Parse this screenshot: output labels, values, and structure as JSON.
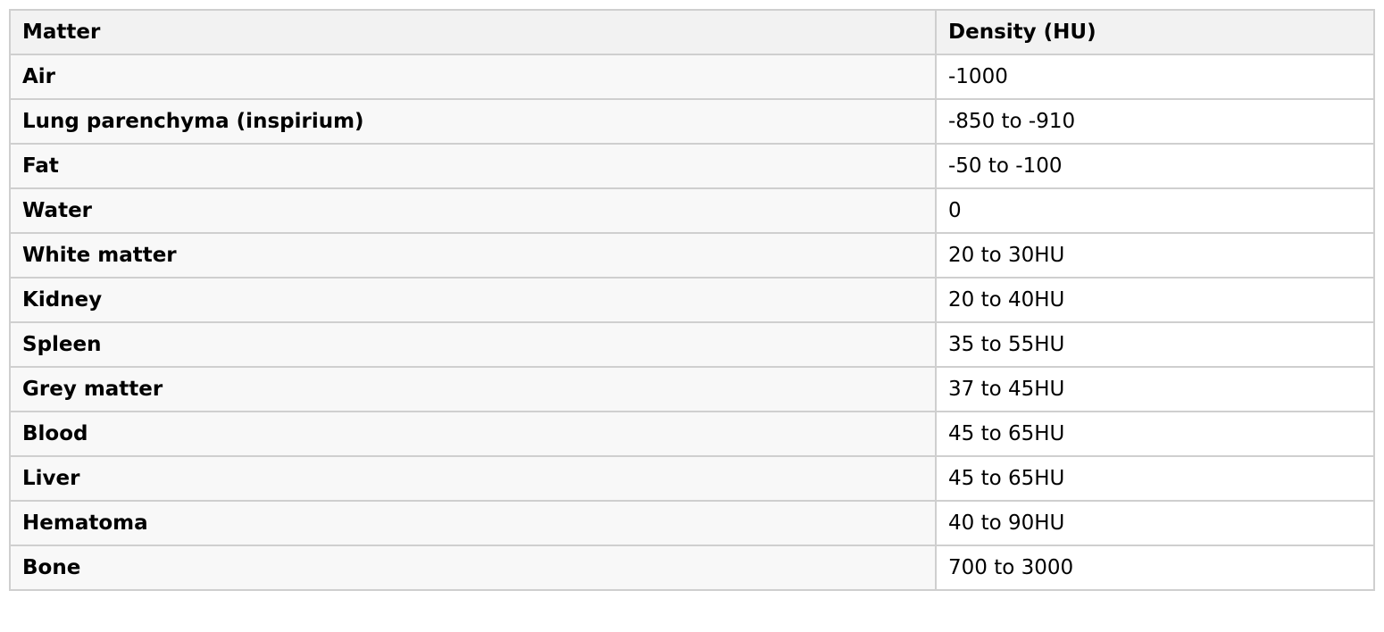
{
  "table": {
    "headers": [
      "Matter",
      "Density (HU)"
    ],
    "rows": [
      {
        "matter": "Air",
        "density": "-1000"
      },
      {
        "matter": "Lung parenchyma (inspirium)",
        "density": "-850 to -910"
      },
      {
        "matter": "Fat",
        "density": "-50 to -100"
      },
      {
        "matter": "Water",
        "density": "0"
      },
      {
        "matter": "White matter",
        "density": "20 to 30HU"
      },
      {
        "matter": "Kidney",
        "density": "20 to 40HU"
      },
      {
        "matter": "Spleen",
        "density": "35 to 55HU"
      },
      {
        "matter": "Grey matter",
        "density": "37 to 45HU"
      },
      {
        "matter": "Blood",
        "density": "45 to 65HU"
      },
      {
        "matter": "Liver",
        "density": "45 to 65HU"
      },
      {
        "matter": "Hematoma",
        "density": "40 to 90HU"
      },
      {
        "matter": "Bone",
        "density": "700 to 3000"
      }
    ]
  }
}
